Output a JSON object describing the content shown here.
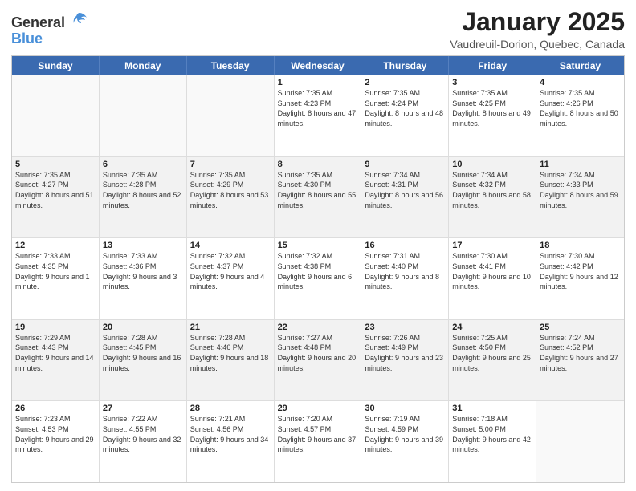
{
  "header": {
    "logo_general": "General",
    "logo_blue": "Blue",
    "title": "January 2025",
    "subtitle": "Vaudreuil-Dorion, Quebec, Canada"
  },
  "day_headers": [
    "Sunday",
    "Monday",
    "Tuesday",
    "Wednesday",
    "Thursday",
    "Friday",
    "Saturday"
  ],
  "weeks": [
    [
      {
        "number": "",
        "sunrise": "",
        "sunset": "",
        "daylight": "",
        "empty": true
      },
      {
        "number": "",
        "sunrise": "",
        "sunset": "",
        "daylight": "",
        "empty": true
      },
      {
        "number": "",
        "sunrise": "",
        "sunset": "",
        "daylight": "",
        "empty": true
      },
      {
        "number": "1",
        "sunrise": "Sunrise: 7:35 AM",
        "sunset": "Sunset: 4:23 PM",
        "daylight": "Daylight: 8 hours and 47 minutes."
      },
      {
        "number": "2",
        "sunrise": "Sunrise: 7:35 AM",
        "sunset": "Sunset: 4:24 PM",
        "daylight": "Daylight: 8 hours and 48 minutes."
      },
      {
        "number": "3",
        "sunrise": "Sunrise: 7:35 AM",
        "sunset": "Sunset: 4:25 PM",
        "daylight": "Daylight: 8 hours and 49 minutes."
      },
      {
        "number": "4",
        "sunrise": "Sunrise: 7:35 AM",
        "sunset": "Sunset: 4:26 PM",
        "daylight": "Daylight: 8 hours and 50 minutes."
      }
    ],
    [
      {
        "number": "5",
        "sunrise": "Sunrise: 7:35 AM",
        "sunset": "Sunset: 4:27 PM",
        "daylight": "Daylight: 8 hours and 51 minutes."
      },
      {
        "number": "6",
        "sunrise": "Sunrise: 7:35 AM",
        "sunset": "Sunset: 4:28 PM",
        "daylight": "Daylight: 8 hours and 52 minutes."
      },
      {
        "number": "7",
        "sunrise": "Sunrise: 7:35 AM",
        "sunset": "Sunset: 4:29 PM",
        "daylight": "Daylight: 8 hours and 53 minutes."
      },
      {
        "number": "8",
        "sunrise": "Sunrise: 7:35 AM",
        "sunset": "Sunset: 4:30 PM",
        "daylight": "Daylight: 8 hours and 55 minutes."
      },
      {
        "number": "9",
        "sunrise": "Sunrise: 7:34 AM",
        "sunset": "Sunset: 4:31 PM",
        "daylight": "Daylight: 8 hours and 56 minutes."
      },
      {
        "number": "10",
        "sunrise": "Sunrise: 7:34 AM",
        "sunset": "Sunset: 4:32 PM",
        "daylight": "Daylight: 8 hours and 58 minutes."
      },
      {
        "number": "11",
        "sunrise": "Sunrise: 7:34 AM",
        "sunset": "Sunset: 4:33 PM",
        "daylight": "Daylight: 8 hours and 59 minutes."
      }
    ],
    [
      {
        "number": "12",
        "sunrise": "Sunrise: 7:33 AM",
        "sunset": "Sunset: 4:35 PM",
        "daylight": "Daylight: 9 hours and 1 minute."
      },
      {
        "number": "13",
        "sunrise": "Sunrise: 7:33 AM",
        "sunset": "Sunset: 4:36 PM",
        "daylight": "Daylight: 9 hours and 3 minutes."
      },
      {
        "number": "14",
        "sunrise": "Sunrise: 7:32 AM",
        "sunset": "Sunset: 4:37 PM",
        "daylight": "Daylight: 9 hours and 4 minutes."
      },
      {
        "number": "15",
        "sunrise": "Sunrise: 7:32 AM",
        "sunset": "Sunset: 4:38 PM",
        "daylight": "Daylight: 9 hours and 6 minutes."
      },
      {
        "number": "16",
        "sunrise": "Sunrise: 7:31 AM",
        "sunset": "Sunset: 4:40 PM",
        "daylight": "Daylight: 9 hours and 8 minutes."
      },
      {
        "number": "17",
        "sunrise": "Sunrise: 7:30 AM",
        "sunset": "Sunset: 4:41 PM",
        "daylight": "Daylight: 9 hours and 10 minutes."
      },
      {
        "number": "18",
        "sunrise": "Sunrise: 7:30 AM",
        "sunset": "Sunset: 4:42 PM",
        "daylight": "Daylight: 9 hours and 12 minutes."
      }
    ],
    [
      {
        "number": "19",
        "sunrise": "Sunrise: 7:29 AM",
        "sunset": "Sunset: 4:43 PM",
        "daylight": "Daylight: 9 hours and 14 minutes."
      },
      {
        "number": "20",
        "sunrise": "Sunrise: 7:28 AM",
        "sunset": "Sunset: 4:45 PM",
        "daylight": "Daylight: 9 hours and 16 minutes."
      },
      {
        "number": "21",
        "sunrise": "Sunrise: 7:28 AM",
        "sunset": "Sunset: 4:46 PM",
        "daylight": "Daylight: 9 hours and 18 minutes."
      },
      {
        "number": "22",
        "sunrise": "Sunrise: 7:27 AM",
        "sunset": "Sunset: 4:48 PM",
        "daylight": "Daylight: 9 hours and 20 minutes."
      },
      {
        "number": "23",
        "sunrise": "Sunrise: 7:26 AM",
        "sunset": "Sunset: 4:49 PM",
        "daylight": "Daylight: 9 hours and 23 minutes."
      },
      {
        "number": "24",
        "sunrise": "Sunrise: 7:25 AM",
        "sunset": "Sunset: 4:50 PM",
        "daylight": "Daylight: 9 hours and 25 minutes."
      },
      {
        "number": "25",
        "sunrise": "Sunrise: 7:24 AM",
        "sunset": "Sunset: 4:52 PM",
        "daylight": "Daylight: 9 hours and 27 minutes."
      }
    ],
    [
      {
        "number": "26",
        "sunrise": "Sunrise: 7:23 AM",
        "sunset": "Sunset: 4:53 PM",
        "daylight": "Daylight: 9 hours and 29 minutes."
      },
      {
        "number": "27",
        "sunrise": "Sunrise: 7:22 AM",
        "sunset": "Sunset: 4:55 PM",
        "daylight": "Daylight: 9 hours and 32 minutes."
      },
      {
        "number": "28",
        "sunrise": "Sunrise: 7:21 AM",
        "sunset": "Sunset: 4:56 PM",
        "daylight": "Daylight: 9 hours and 34 minutes."
      },
      {
        "number": "29",
        "sunrise": "Sunrise: 7:20 AM",
        "sunset": "Sunset: 4:57 PM",
        "daylight": "Daylight: 9 hours and 37 minutes."
      },
      {
        "number": "30",
        "sunrise": "Sunrise: 7:19 AM",
        "sunset": "Sunset: 4:59 PM",
        "daylight": "Daylight: 9 hours and 39 minutes."
      },
      {
        "number": "31",
        "sunrise": "Sunrise: 7:18 AM",
        "sunset": "Sunset: 5:00 PM",
        "daylight": "Daylight: 9 hours and 42 minutes."
      },
      {
        "number": "",
        "sunrise": "",
        "sunset": "",
        "daylight": "",
        "empty": true
      }
    ]
  ]
}
